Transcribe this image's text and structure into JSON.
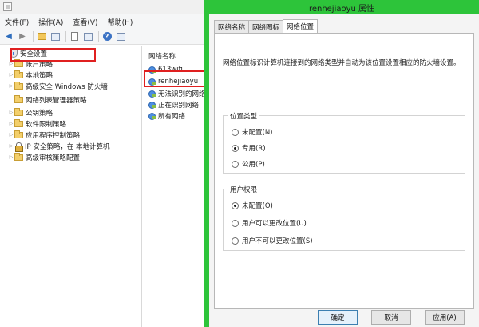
{
  "menu": [
    "文件(F)",
    "操作(A)",
    "查看(V)",
    "帮助(H)"
  ],
  "tree": [
    {
      "label": "安全设置",
      "icon": "security-settings-icon",
      "expander": "none"
    },
    {
      "label": "帐户策略",
      "icon": "folder-icon",
      "expander": "collapsed"
    },
    {
      "label": "本地策略",
      "icon": "folder-icon",
      "expander": "collapsed"
    },
    {
      "label": "高级安全 Windows 防火墙",
      "icon": "folder-icon",
      "expander": "collapsed"
    },
    {
      "label": "网络列表管理器策略",
      "icon": "folder-icon",
      "expander": "none"
    },
    {
      "label": "公钥策略",
      "icon": "folder-icon",
      "expander": "collapsed"
    },
    {
      "label": "软件限制策略",
      "icon": "folder-icon",
      "expander": "collapsed"
    },
    {
      "label": "应用程序控制策略",
      "icon": "folder-icon",
      "expander": "collapsed"
    },
    {
      "label": "IP 安全策略，在 本地计算机",
      "icon": "ip-security-icon",
      "expander": "collapsed"
    },
    {
      "label": "高级审核策略配置",
      "icon": "folder-icon",
      "expander": "collapsed"
    }
  ],
  "list": {
    "header": "网络名称",
    "items": [
      "613wifi",
      "renhejiaoyu",
      "无法识别的网络",
      "正在识别网络",
      "所有网络"
    ]
  },
  "dialog": {
    "title": "renhejiaoyu 属性",
    "tabs": [
      "网络名称",
      "网络图标",
      "网络位置"
    ],
    "active_tab": "网络位置",
    "description": "网络位置标识计算机连接到的网络类型并自动为该位置设置相应的防火墙设置。",
    "location_group": {
      "label": "位置类型",
      "options": [
        "未配置(N)",
        "专用(R)",
        "公用(P)"
      ],
      "selected": "专用(R)"
    },
    "permission_group": {
      "label": "用户权限",
      "options": [
        "未配置(O)",
        "用户可以更改位置(U)",
        "用户不可以更改位置(S)"
      ],
      "selected": "未配置(O)"
    },
    "buttons": {
      "ok": "确定",
      "cancel": "取消",
      "apply": "应用(A)"
    }
  }
}
